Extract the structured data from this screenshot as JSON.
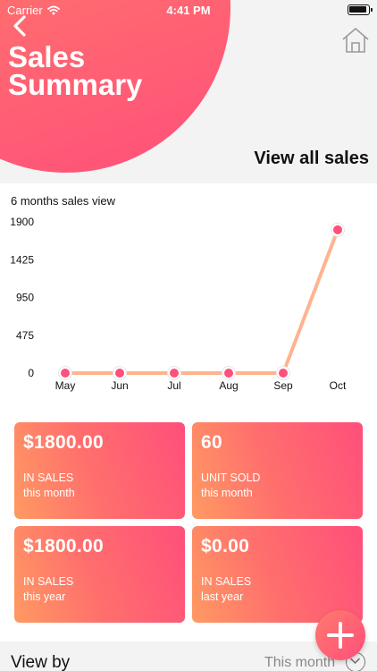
{
  "status_bar": {
    "carrier": "Carrier",
    "time": "4:41 PM"
  },
  "header": {
    "title": "Sales Summary",
    "view_all": "View all sales"
  },
  "chart_title": "6 months sales view",
  "chart_data": {
    "type": "line",
    "categories": [
      "May",
      "Jun",
      "Jul",
      "Aug",
      "Sep",
      "Oct"
    ],
    "values": [
      0,
      0,
      0,
      0,
      0,
      1800
    ],
    "y_ticks": [
      "0",
      "475",
      "950",
      "1425",
      "1900"
    ],
    "ylim": [
      0,
      1900
    ],
    "title": "",
    "xlabel": "",
    "ylabel": "",
    "line_color": "#ffb38f",
    "point_color": "#ff4f7b"
  },
  "cards": [
    {
      "value": "$1800.00",
      "label": "IN SALES",
      "sub": "this month"
    },
    {
      "value": "60",
      "label": "UNIT SOLD",
      "sub": "this month"
    },
    {
      "value": "$1800.00",
      "label": "IN SALES",
      "sub": "this year"
    },
    {
      "value": "$0.00",
      "label": "IN SALES",
      "sub": "last year"
    }
  ],
  "footer": {
    "view_by": "View by",
    "period": "This month"
  },
  "colors": {
    "accent_start": "#ff9a62",
    "accent_end": "#ff4f7b"
  }
}
